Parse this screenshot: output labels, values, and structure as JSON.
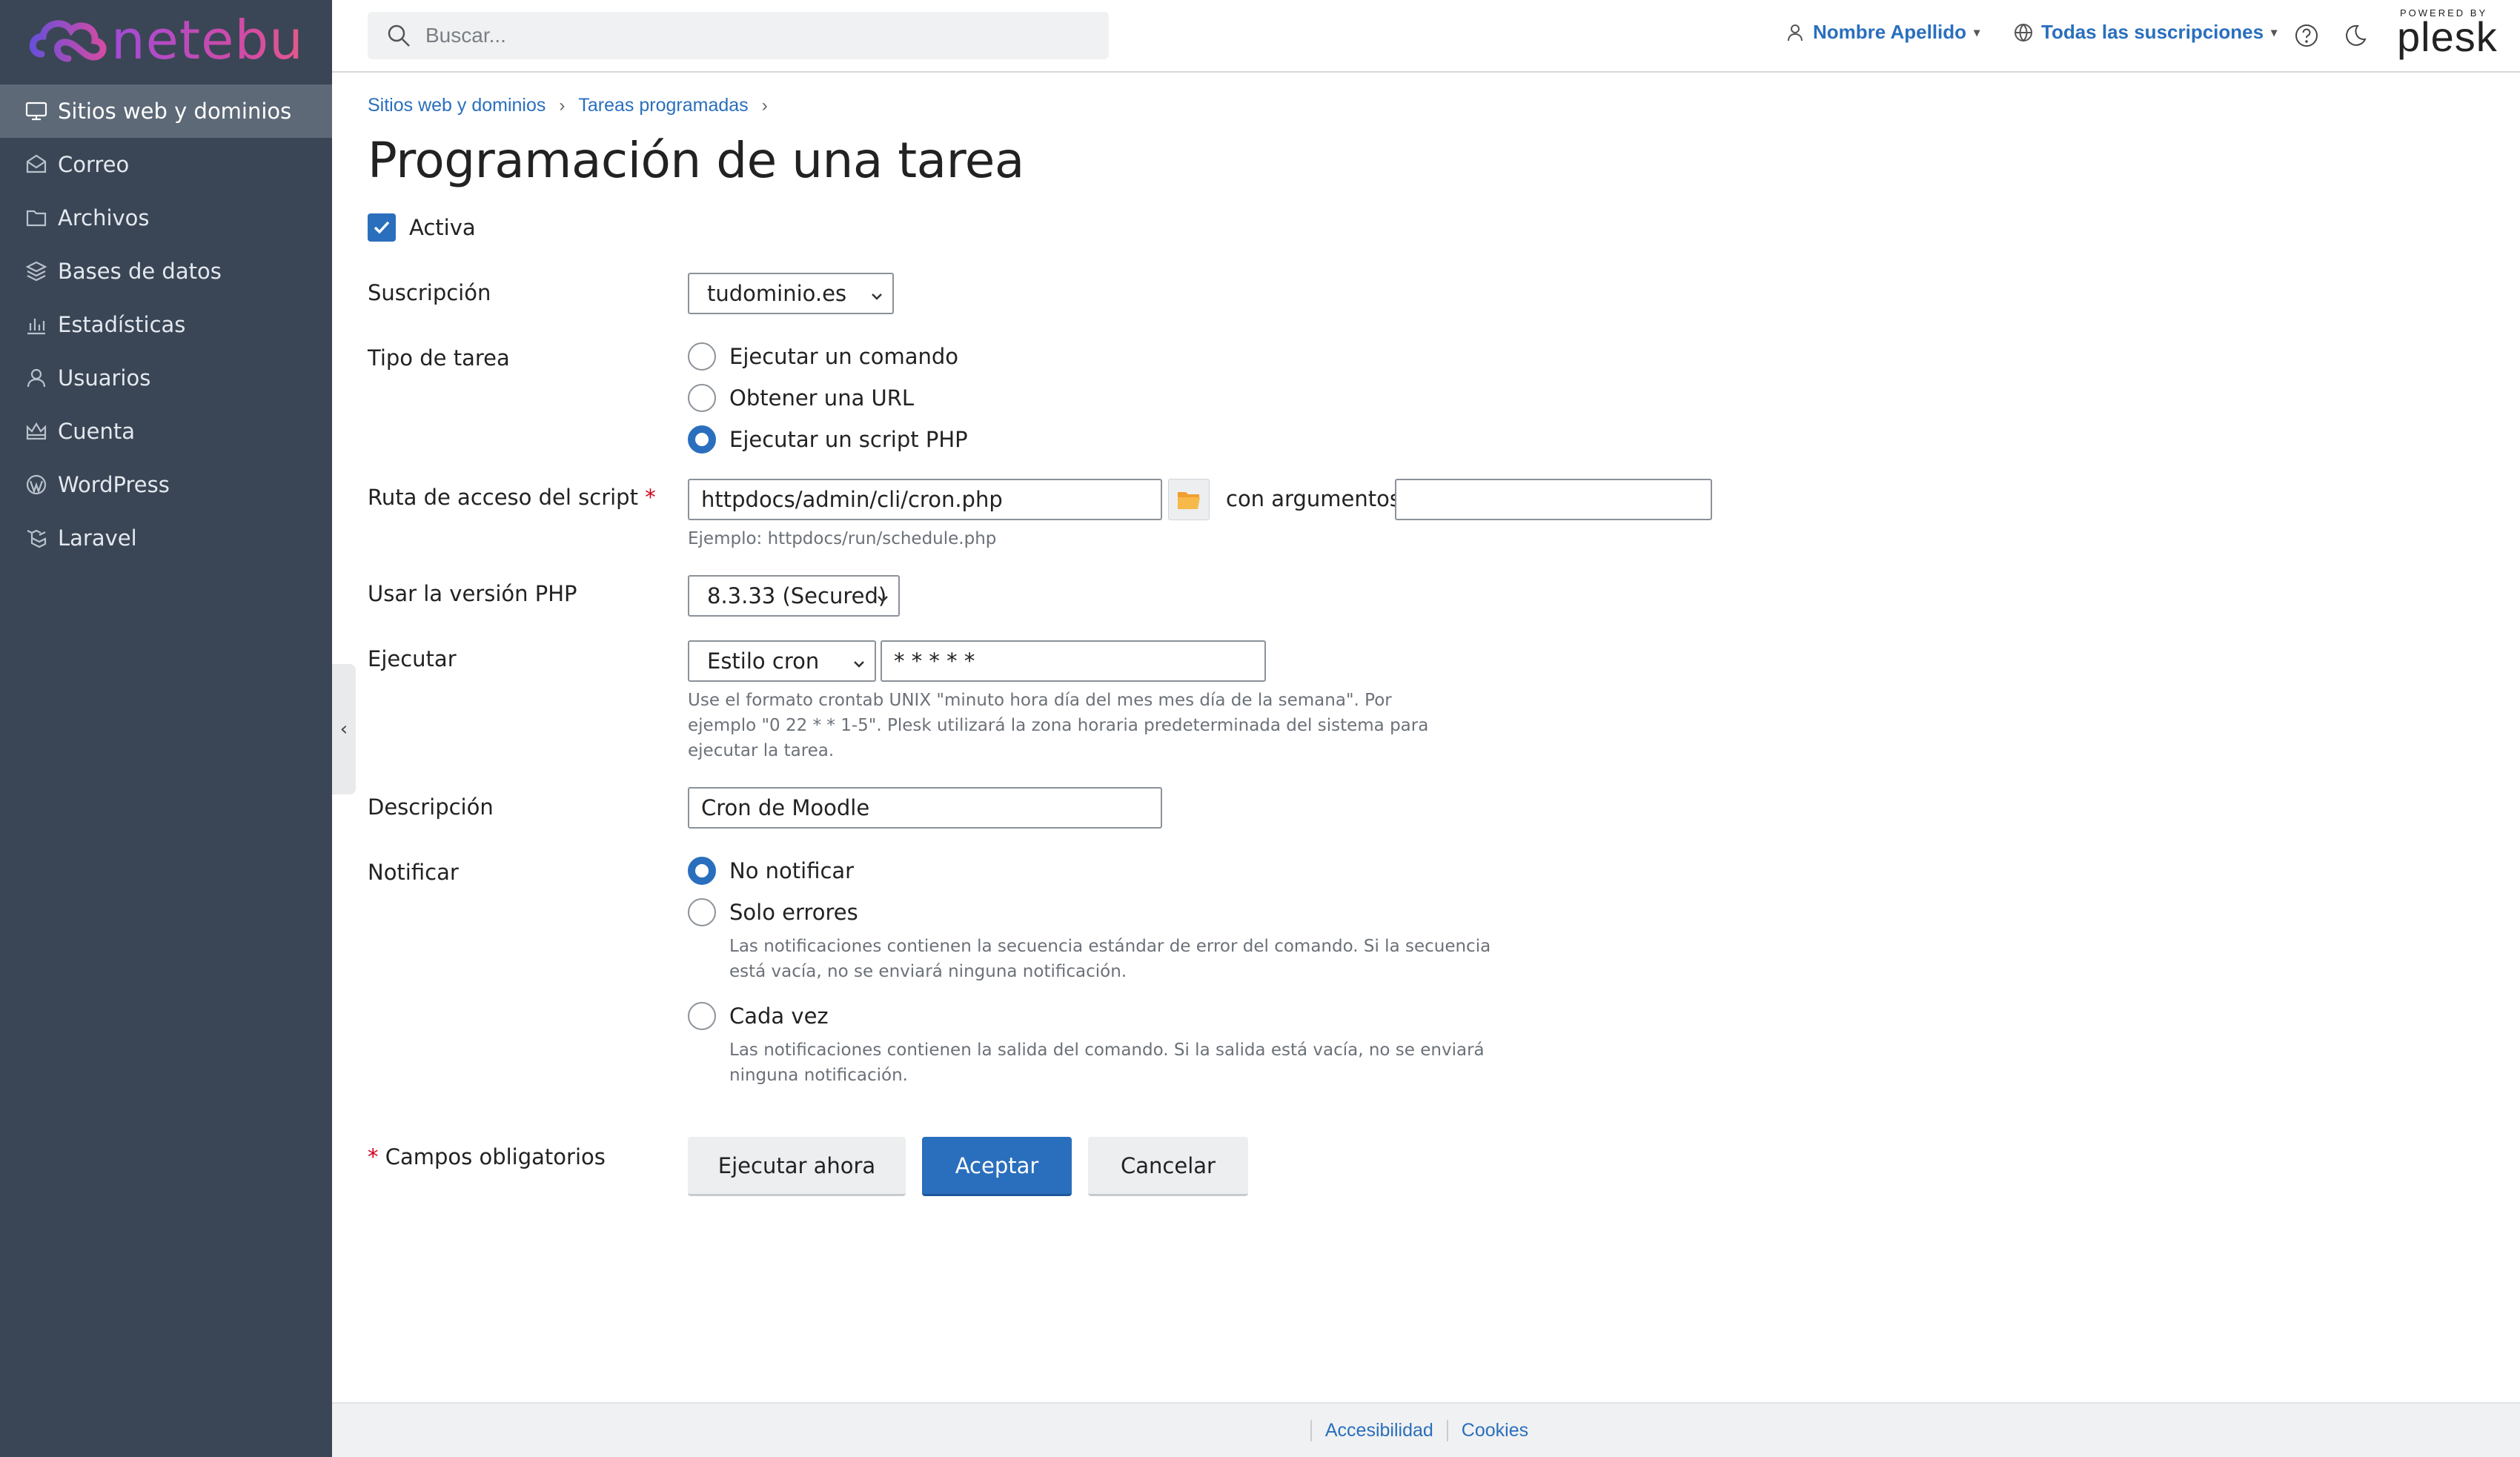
{
  "brand": {
    "name": "netebu"
  },
  "sidebar": {
    "items": [
      {
        "label": "Sitios web y dominios",
        "icon": "monitor-icon",
        "active": true
      },
      {
        "label": "Correo",
        "icon": "mail-icon"
      },
      {
        "label": "Archivos",
        "icon": "folder-icon"
      },
      {
        "label": "Bases de datos",
        "icon": "database-icon"
      },
      {
        "label": "Estadísticas",
        "icon": "bar-chart-icon"
      },
      {
        "label": "Usuarios",
        "icon": "user-icon"
      },
      {
        "label": "Cuenta",
        "icon": "crown-icon"
      },
      {
        "label": "WordPress",
        "icon": "wordpress-icon"
      },
      {
        "label": "Laravel",
        "icon": "laravel-icon"
      }
    ]
  },
  "header": {
    "search_placeholder": "Buscar...",
    "user_name": "Nombre Apellido",
    "subscriptions": "Todas las suscripciones",
    "plesk_powered": "POWERED BY",
    "plesk_word": "plesk"
  },
  "breadcrumb": [
    "Sitios web y dominios",
    "Tareas programadas"
  ],
  "page_title": "Programación de una tarea",
  "form": {
    "active_label": "Activa",
    "active_checked": true,
    "subscription": {
      "label": "Suscripción",
      "value": "tudominio.es"
    },
    "task_type": {
      "label": "Tipo de tarea",
      "options": [
        "Ejecutar un comando",
        "Obtener una URL",
        "Ejecutar un script PHP"
      ],
      "selected": "Ejecutar un script PHP"
    },
    "script_path": {
      "label": "Ruta de acceso del script",
      "required_mark": "*",
      "value": "httpdocs/admin/cli/cron.php",
      "args_label": "con argumentos",
      "args_value": "",
      "hint": "Ejemplo: httpdocs/run/schedule.php"
    },
    "php_version": {
      "label": "Usar la versión PHP",
      "value": "8.3.33 (Secured)"
    },
    "run": {
      "label": "Ejecutar",
      "style": "Estilo cron",
      "cron": "* * * * *",
      "hint_lines": [
        "Use el formato crontab UNIX \"minuto hora día del mes mes día de la semana\". Por",
        "ejemplo \"0 22 * * 1-5\". Plesk utilizará la zona horaria predeterminada del sistema para",
        "ejecutar la tarea."
      ]
    },
    "description": {
      "label": "Descripción",
      "value": "Cron de Moodle"
    },
    "notify": {
      "label": "Notificar",
      "options": [
        {
          "label": "No notificar",
          "selected": true,
          "hint_lines": []
        },
        {
          "label": "Solo errores",
          "selected": false,
          "hint_lines": [
            "Las notificaciones contienen la secuencia estándar de error del comando. Si la secuencia",
            "está vacía, no se enviará ninguna notificación."
          ]
        },
        {
          "label": "Cada vez",
          "selected": false,
          "hint_lines": [
            "Las notificaciones contienen la salida del comando. Si la salida está vacía, no se enviará",
            "ninguna notificación."
          ]
        }
      ]
    },
    "required_note": "Campos obligatorios",
    "buttons": {
      "run_now": "Ejecutar ahora",
      "accept": "Aceptar",
      "cancel": "Cancelar"
    }
  },
  "footer": {
    "links": [
      "Accesibilidad",
      "Cookies"
    ]
  },
  "colors": {
    "sidebar_bg": "#3a4655",
    "accent": "#2a6fbd",
    "required": "#d0021b"
  }
}
